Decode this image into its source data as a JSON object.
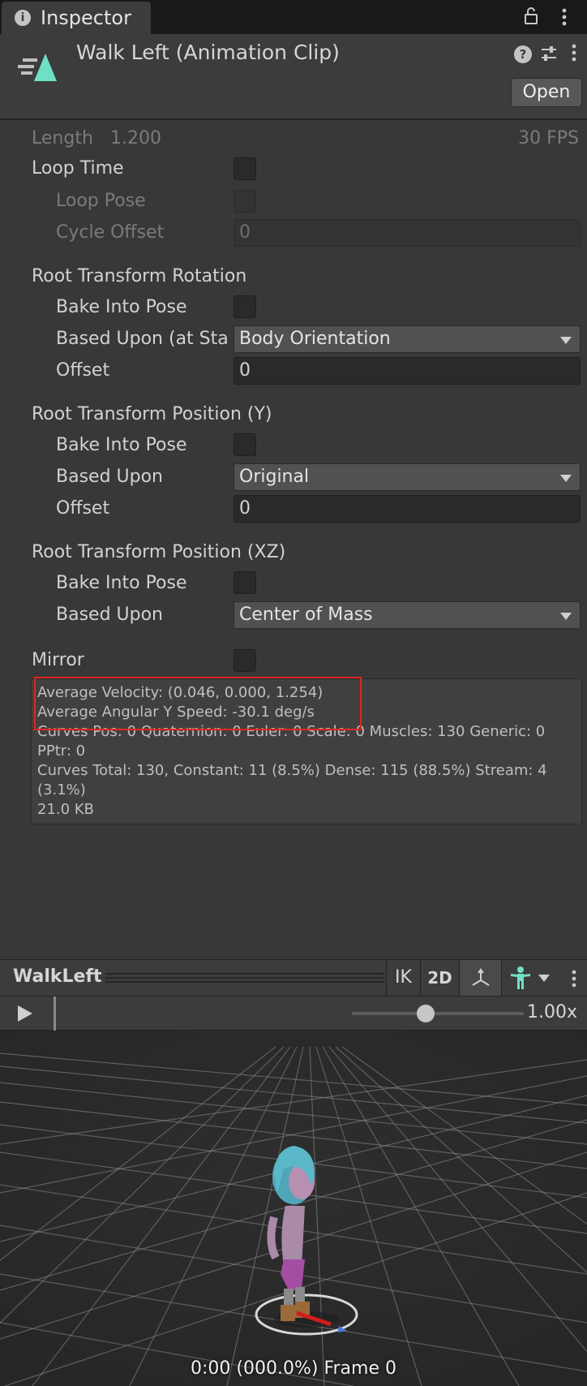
{
  "tab": {
    "title": "Inspector"
  },
  "header": {
    "title": "Walk Left (Animation Clip)",
    "open_label": "Open"
  },
  "clip_info": {
    "length_label": "Length",
    "length_value": "1.200",
    "fps": "30 FPS"
  },
  "loop": {
    "loop_time": "Loop Time",
    "loop_pose": "Loop Pose",
    "cycle_offset": "Cycle Offset",
    "cycle_offset_value": "0"
  },
  "root_rotation": {
    "title": "Root Transform Rotation",
    "bake": "Bake Into Pose",
    "based_upon": "Based Upon (at Sta",
    "based_upon_value": "Body Orientation",
    "offset": "Offset",
    "offset_value": "0"
  },
  "root_position_y": {
    "title": "Root Transform Position (Y)",
    "bake": "Bake Into Pose",
    "based_upon": "Based Upon",
    "based_upon_value": "Original",
    "offset": "Offset",
    "offset_value": "0"
  },
  "root_position_xz": {
    "title": "Root Transform Position (XZ)",
    "bake": "Bake Into Pose",
    "based_upon": "Based Upon",
    "based_upon_value": "Center of Mass"
  },
  "mirror": {
    "label": "Mirror"
  },
  "info": {
    "line1": "Average Velocity: (0.046, 0.000, 1.254)",
    "line2": "Average Angular Y Speed: -30.1 deg/s",
    "line3": "Curves Pos: 0 Quaternion: 0 Euler: 0 Scale: 0 Muscles: 130 Generic: 0",
    "line4": "PPtr: 0",
    "line5": "Curves Total: 130, Constant: 11 (8.5%) Dense: 115 (88.5%) Stream: 4",
    "line6": "(3.1%)",
    "line7": "21.0 KB"
  },
  "preview": {
    "name": "WalkLeft",
    "ik_label": "IK",
    "twod_label": "2D",
    "speed": "1.00x",
    "speed_fraction": 0.43,
    "frame_label": "0:00 (000.0%) Frame 0"
  },
  "colors": {
    "accent": "#6fe0c6",
    "highlight": "#e0261e",
    "panel": "#383838"
  },
  "icons": [
    "info-icon",
    "lock-icon",
    "kebab-icon",
    "animation-clip-icon",
    "help-icon",
    "settings-icon",
    "caret-down-icon",
    "pivot-icon",
    "avatar-icon",
    "play-icon"
  ]
}
